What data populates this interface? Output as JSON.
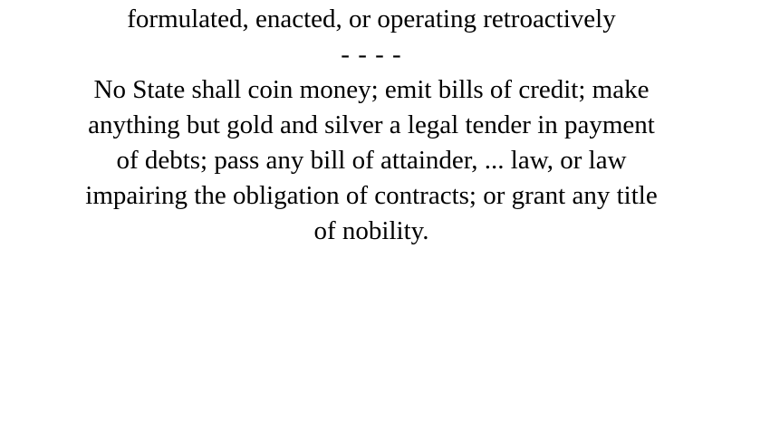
{
  "document": {
    "definition_tail": "formulated, enacted, or operating retroactively",
    "separator": "- - - -",
    "quote_lines": [
      "No State shall coin money; emit bills of credit; make",
      "anything but gold and silver a legal tender in payment",
      "of debts; pass any bill of attainder, ... law, or law",
      "impairing the obligation of contracts; or grant any title",
      "of nobility."
    ]
  }
}
